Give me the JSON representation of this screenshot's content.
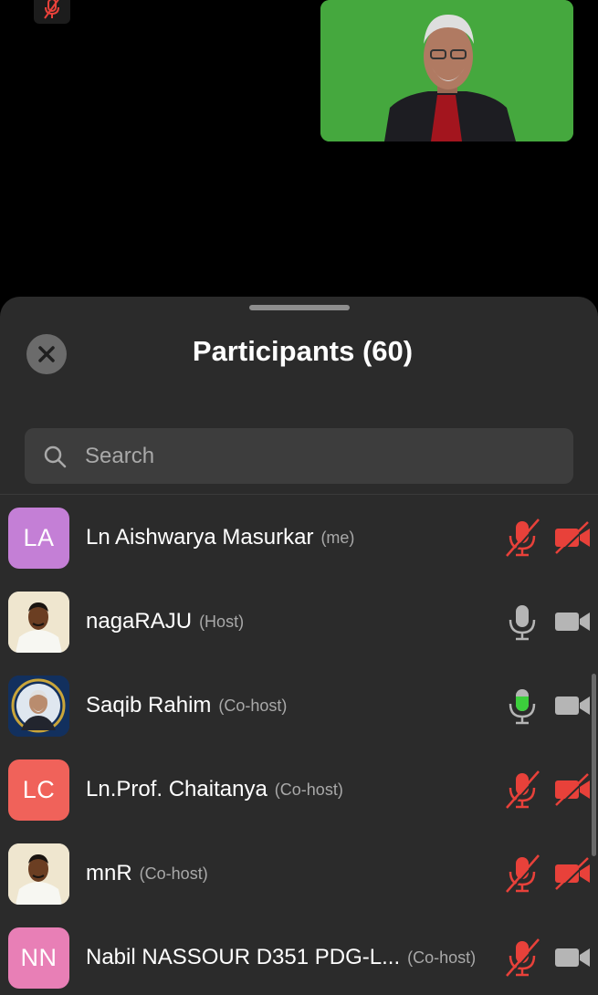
{
  "meeting": {
    "self_muted_badge_icon": "mic-off-icon"
  },
  "panel": {
    "title": "Participants (60)",
    "close_icon": "close-icon"
  },
  "search": {
    "placeholder": "Search",
    "value": ""
  },
  "participants": [
    {
      "name": "Ln Aishwarya Masurkar",
      "role": "(me)",
      "avatar_initials": "LA",
      "avatar_color": "#c47fd6",
      "mic": "muted",
      "video": "off"
    },
    {
      "name": "nagaRAJU",
      "role": "(Host)",
      "avatar_initials": "",
      "avatar_color": "",
      "mic": "on",
      "video": "on"
    },
    {
      "name": "Saqib Rahim",
      "role": "(Co-host)",
      "avatar_initials": "",
      "avatar_color": "",
      "mic": "speaking",
      "video": "on"
    },
    {
      "name": "Ln.Prof. Chaitanya",
      "role": "(Co-host)",
      "avatar_initials": "LC",
      "avatar_color": "#f0625a",
      "mic": "muted",
      "video": "off"
    },
    {
      "name": "mnR",
      "role": "(Co-host)",
      "avatar_initials": "",
      "avatar_color": "",
      "mic": "muted",
      "video": "off"
    },
    {
      "name": "Nabil NASSOUR D351 PDG-L...",
      "role": "(Co-host)",
      "avatar_initials": "NN",
      "avatar_color": "#e87fb6",
      "mic": "muted",
      "video": "on"
    }
  ],
  "colors": {
    "muted_red": "#e8413a",
    "speaking_green": "#3ccf3c",
    "icon_gray": "#b5b5b5",
    "sheet_bg": "#2b2b2b"
  }
}
